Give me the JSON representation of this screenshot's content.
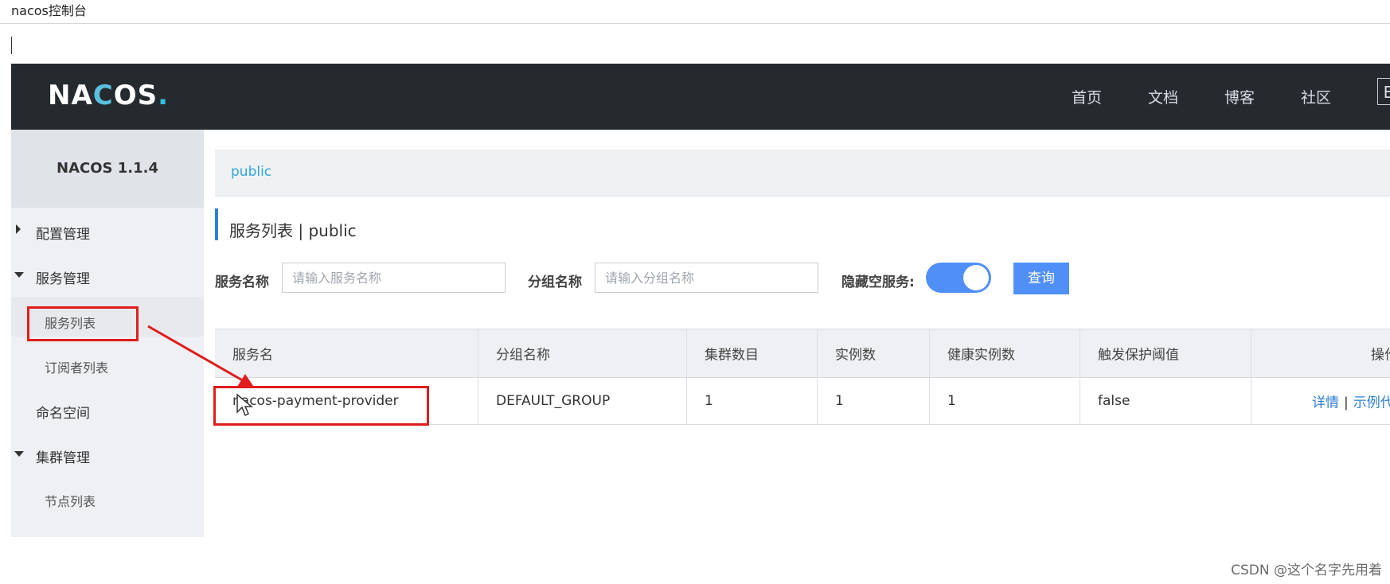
{
  "window": {
    "title": "nacos控制台"
  },
  "header": {
    "logo": "NACOS.",
    "nav": [
      "首页",
      "文档",
      "博客",
      "社区"
    ],
    "lang_label": "E"
  },
  "sidebar": {
    "version": "NACOS 1.1.4",
    "items": [
      {
        "label": "配置管理",
        "expanded": false
      },
      {
        "label": "服务管理",
        "expanded": true,
        "children": [
          "服务列表",
          "订阅者列表"
        ]
      },
      {
        "label": "命名空间"
      },
      {
        "label": "集群管理",
        "expanded": true,
        "children": [
          "节点列表"
        ]
      }
    ]
  },
  "breadcrumb": {
    "namespace": "public"
  },
  "page": {
    "title": "服务列表 | public"
  },
  "filters": {
    "service_name_label": "服务名称",
    "service_name_placeholder": "请输入服务名称",
    "group_name_label": "分组名称",
    "group_name_placeholder": "请输入分组名称",
    "hide_empty_label": "隐藏空服务:",
    "hide_empty_on": true,
    "query_button": "查询"
  },
  "table": {
    "columns": [
      "服务名",
      "分组名称",
      "集群数目",
      "实例数",
      "健康实例数",
      "触发保护阈值",
      "操作"
    ],
    "rows": [
      {
        "service_name": "nacos-payment-provider",
        "group": "DEFAULT_GROUP",
        "clusters": "1",
        "instances": "1",
        "healthy_instances": "1",
        "protect_threshold": "false",
        "actions": [
          "详情",
          "示例代码"
        ]
      }
    ]
  },
  "watermark": "CSDN @这个名字先用着",
  "colors": {
    "accent": "#4f8ff7",
    "header_bg": "#252a2f",
    "annotation_red": "#e01c1c"
  }
}
